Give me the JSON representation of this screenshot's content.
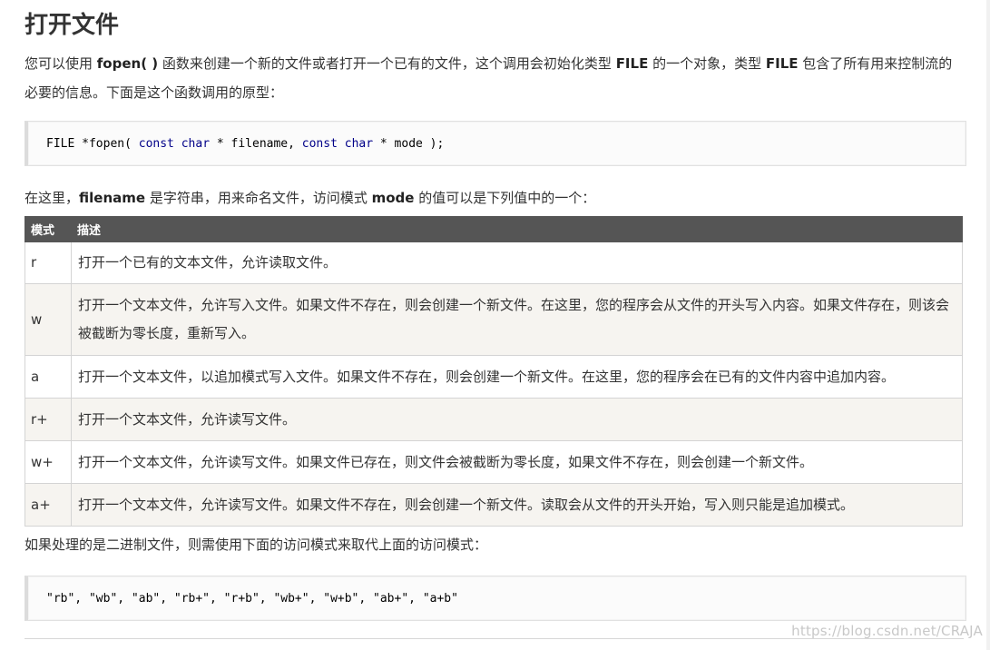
{
  "section_title": "打开文件",
  "intro": {
    "t1": "您可以使用 ",
    "b1": "fopen( )",
    "t2": " 函数来创建一个新的文件或者打开一个已有的文件，这个调用会初始化类型 ",
    "b2": "FILE",
    "t3": " 的一个对象，类型 ",
    "b3": "FILE",
    "t4": " 包含了所有用来控制流的必要的信息。下面是这个函数调用的原型："
  },
  "prototype_code": {
    "p1": "FILE *fopen( ",
    "k1": "const char",
    "p2": " * filename, ",
    "k2": "const char",
    "p3": " * mode );"
  },
  "mode_intro": {
    "t1": "在这里，",
    "b1": "filename",
    "t2": " 是字符串，用来命名文件，访问模式 ",
    "b2": "mode",
    "t3": " 的值可以是下列值中的一个："
  },
  "table": {
    "headers": [
      "模式",
      "描述"
    ],
    "rows": [
      {
        "mode": "r",
        "desc": "打开一个已有的文本文件，允许读取文件。"
      },
      {
        "mode": "w",
        "desc": "打开一个文本文件，允许写入文件。如果文件不存在，则会创建一个新文件。在这里，您的程序会从文件的开头写入内容。如果文件存在，则该会被截断为零长度，重新写入。"
      },
      {
        "mode": "a",
        "desc": "打开一个文本文件，以追加模式写入文件。如果文件不存在，则会创建一个新文件。在这里，您的程序会在已有的文件内容中追加内容。"
      },
      {
        "mode": "r+",
        "desc": "打开一个文本文件，允许读写文件。"
      },
      {
        "mode": "w+",
        "desc": "打开一个文本文件，允许读写文件。如果文件已存在，则文件会被截断为零长度，如果文件不存在，则会创建一个新文件。"
      },
      {
        "mode": "a+",
        "desc": "打开一个文本文件，允许读写文件。如果文件不存在，则会创建一个新文件。读取会从文件的开头开始，写入则只能是追加模式。"
      }
    ]
  },
  "binary_note": "如果处理的是二进制文件，则需使用下面的访问模式来取代上面的访问模式：",
  "binary_modes_code": "\"rb\", \"wb\", \"ab\", \"rb+\", \"r+b\", \"wb+\", \"w+b\", \"ab+\", \"a+b\"",
  "watermark": "https://blog.csdn.net/CRAJA"
}
